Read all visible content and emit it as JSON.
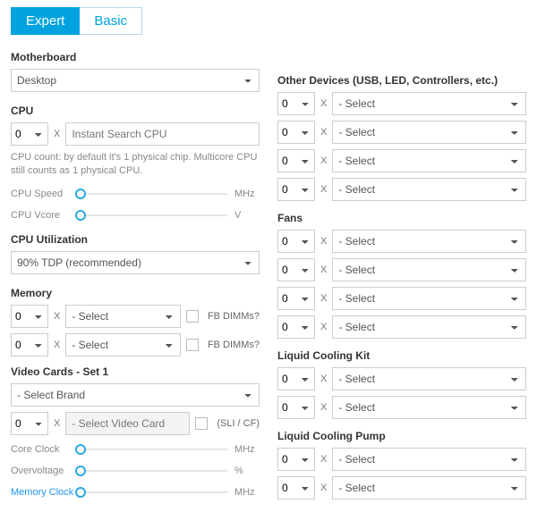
{
  "tabs": {
    "expert": "Expert",
    "basic": "Basic"
  },
  "x": "X",
  "left": {
    "motherboard": {
      "label": "Motherboard",
      "value": "Desktop"
    },
    "cpu": {
      "label": "CPU",
      "qty": "0",
      "placeholder": "Instant Search CPU",
      "hint": "CPU count: by default it's 1 physical chip. Multicore CPU still counts as 1 physical CPU.",
      "speed_label": "CPU Speed",
      "speed_unit": "MHz",
      "vcore_label": "CPU Vcore",
      "vcore_unit": "V"
    },
    "cpu_util": {
      "label": "CPU Utilization",
      "value": "90% TDP (recommended)"
    },
    "memory": {
      "label": "Memory",
      "rows": [
        {
          "qty": "0",
          "value": "- Select",
          "fb": "FB DIMMs?"
        },
        {
          "qty": "0",
          "value": "- Select",
          "fb": "FB DIMMs?"
        }
      ]
    },
    "video": {
      "label": "Video Cards - Set 1",
      "brand": "- Select Brand",
      "qty": "0",
      "card_placeholder": "- Select Video Card",
      "sli": "(SLI / CF)",
      "core_label": "Core Clock",
      "core_unit": "MHz",
      "ov_label": "Overvoltage",
      "ov_unit": "%",
      "mem_label": "Memory Clock",
      "mem_unit": "MHz"
    }
  },
  "right": {
    "other": {
      "label": "Other Devices (USB, LED, Controllers, etc.)",
      "rows": [
        {
          "qty": "0",
          "value": "- Select"
        },
        {
          "qty": "0",
          "value": "- Select"
        },
        {
          "qty": "0",
          "value": "- Select"
        },
        {
          "qty": "0",
          "value": "- Select"
        }
      ]
    },
    "fans": {
      "label": "Fans",
      "rows": [
        {
          "qty": "0",
          "value": "- Select"
        },
        {
          "qty": "0",
          "value": "- Select"
        },
        {
          "qty": "0",
          "value": "- Select"
        },
        {
          "qty": "0",
          "value": "- Select"
        }
      ]
    },
    "lck": {
      "label": "Liquid Cooling Kit",
      "rows": [
        {
          "qty": "0",
          "value": "- Select"
        },
        {
          "qty": "0",
          "value": "- Select"
        }
      ]
    },
    "lcp": {
      "label": "Liquid Cooling Pump",
      "rows": [
        {
          "qty": "0",
          "value": "- Select"
        },
        {
          "qty": "0",
          "value": "- Select"
        }
      ]
    }
  }
}
